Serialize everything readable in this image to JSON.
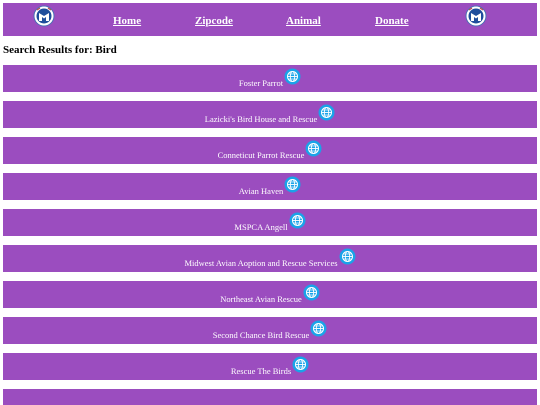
{
  "nav": {
    "home": "Home",
    "zipcode": "Zipcode",
    "animal": "Animal",
    "donate": "Donate",
    "logo_icon": "site-logo-icon"
  },
  "heading": "Search Results for: Bird",
  "results": [
    {
      "name": "Foster Parrot"
    },
    {
      "name": "Lazicki's Bird House and Rescue"
    },
    {
      "name": "Conneticut Parrot Rescue"
    },
    {
      "name": "Avian Haven"
    },
    {
      "name": "MSPCA Angell"
    },
    {
      "name": "Midwest Avian Aoption and Rescue Services"
    },
    {
      "name": "Northeast Avian Rescue"
    },
    {
      "name": "Second Chance Bird Rescue"
    },
    {
      "name": "Rescue The Birds"
    }
  ],
  "colors": {
    "accent": "#9b4dbf",
    "globe": "#1aa3e8",
    "text": "#ffffff"
  },
  "icons": {
    "website": "globe-icon"
  }
}
